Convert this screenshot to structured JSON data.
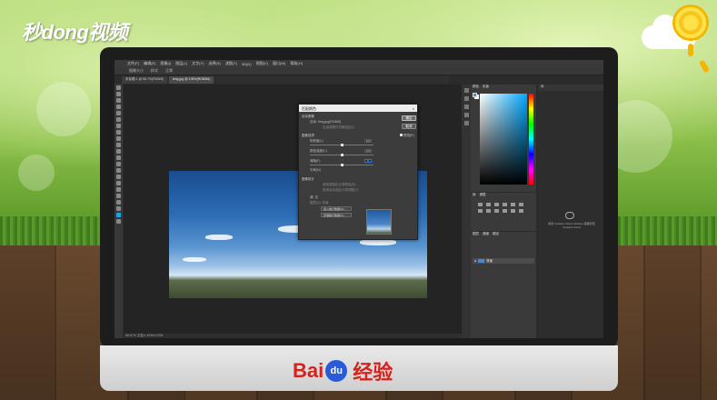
{
  "brand": {
    "text": "秒dong视频"
  },
  "footer": {
    "logo_bai": "Bai",
    "logo_du": "du",
    "logo_suffix": "经验"
  },
  "photoshop": {
    "menu": [
      "文件(F)",
      "编辑(E)",
      "图像(I)",
      "图层(L)",
      "文字(Y)",
      "选择(S)",
      "滤镜(T)",
      "3D(D)",
      "视图(V)",
      "窗口(W)",
      "帮助(H)"
    ],
    "options": [
      "图像大小",
      "样式",
      "正常"
    ],
    "tabs": [
      {
        "label": "未标题-1 @ 66.7%(RGB/8)",
        "active": false
      },
      {
        "label": "timg.jpg @ 105%(RGB/8#)",
        "active": true
      }
    ],
    "status": "66.67%  文档:1.57M/1.57M",
    "color_panel_tabs": [
      "颜色",
      "色板"
    ],
    "adjust_panel_tabs": [
      "库",
      "调整"
    ],
    "layers_panel_tabs": [
      "图层",
      "通道",
      "路径"
    ],
    "layer_name": "背景",
    "right_panel_tab": "库",
    "cc_text": "使用 Creative Cloud Libraries 需要安装 Creative Cloud"
  },
  "dialog": {
    "title": "匹配颜色",
    "close": "×",
    "target_section": "目标图像",
    "target_label": "目标:",
    "target_value": "timg.jpg(RGB/8)",
    "ignore_selection": "应用调整时忽略选区(I)",
    "image_options": "图像选项",
    "luminance_label": "明亮度(L)",
    "luminance_value": "100",
    "intensity_label": "颜色强度(C)",
    "intensity_value": "100",
    "fade_label": "渐隐(F)",
    "fade_value": "0",
    "neutralize": "中和(N)",
    "stats_section": "图像统计",
    "use_source_sel": "使用源选区计算颜色(R)",
    "use_target_sel": "使用目标选区计算调整(T)",
    "source_label": "源:",
    "source_value": "无",
    "layer_label": "图层(A):",
    "layer_value": "背景",
    "load_stats": "载入统计数据(O)...",
    "save_stats": "存储统计数据(V)...",
    "ok": "确定",
    "cancel": "取消",
    "preview": "预览(P)"
  }
}
